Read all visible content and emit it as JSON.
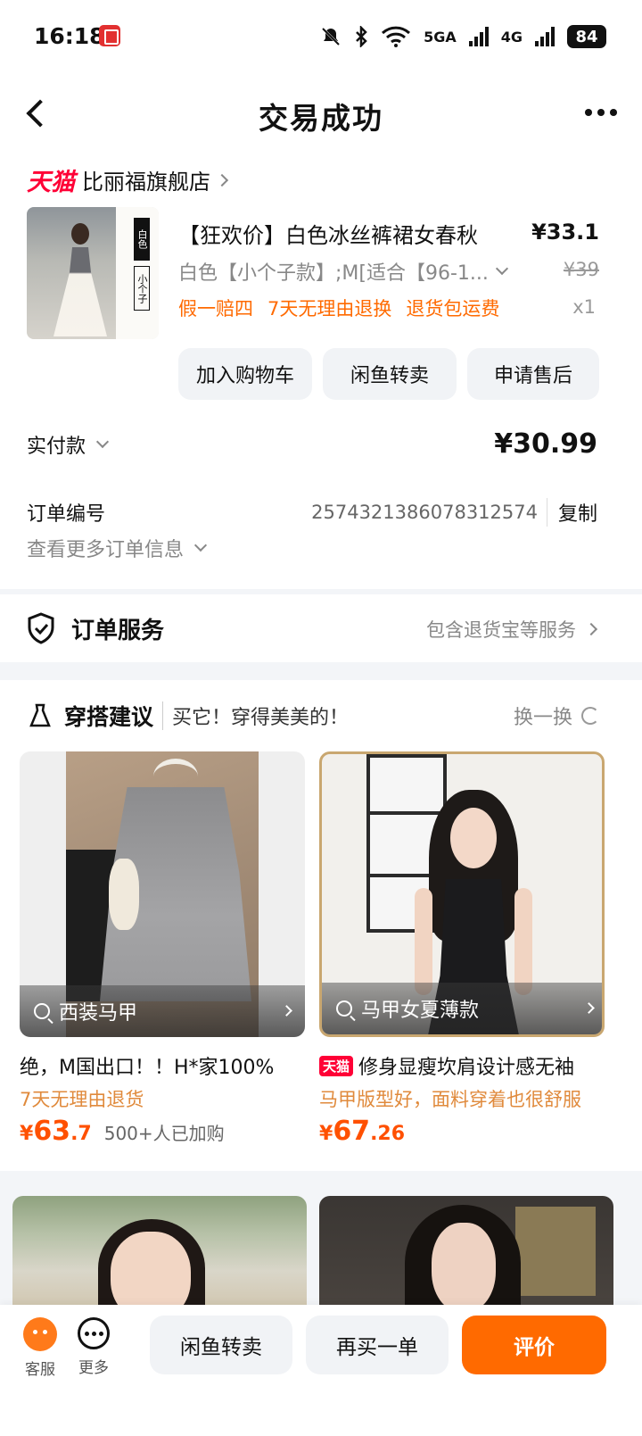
{
  "status_bar": {
    "time": "16:18",
    "net1": "5GA",
    "net2": "4G",
    "battery": "84"
  },
  "header": {
    "title": "交易成功"
  },
  "shop": {
    "platform_logo": "天猫",
    "name": "比丽福旗舰店"
  },
  "product": {
    "title": "【狂欢价】白色冰丝裤裙女春秋",
    "price": "¥33.1",
    "sku": "白色【小个子款】;M[适合【96-1...",
    "original_price": "¥39",
    "guarantees": [
      "假一赔四",
      "7天无理由退换",
      "退货包运费"
    ],
    "quantity": "x1",
    "thumb_tag1": "白色",
    "thumb_tag2": "小个子"
  },
  "actions": {
    "add_cart": "加入购物车",
    "resell": "闲鱼转卖",
    "after_sale": "申请售后"
  },
  "payment": {
    "label": "实付款",
    "amount": "¥30.99"
  },
  "order": {
    "label": "订单编号",
    "number": "2574321386078312574",
    "copy": "复制",
    "more": "查看更多订单信息"
  },
  "service": {
    "title": "订单服务",
    "link": "包含退货宝等服务"
  },
  "outfit": {
    "title": "穿搭建议",
    "subtitle": "买它！穿得美美的！",
    "refresh": "换一换",
    "items": [
      {
        "search_tag": "西装马甲",
        "title": "绝，M国出口！！H*家100%",
        "subtitle": "7天无理由退货",
        "price_yen": "¥",
        "price_int": "63",
        "price_dec": ".7",
        "extra": "500+人已加购",
        "badge": ""
      },
      {
        "search_tag": "马甲女夏薄款",
        "title": "修身显瘦坎肩设计感无袖",
        "subtitle": "马甲版型好，面料穿着也很舒服",
        "price_yen": "¥",
        "price_int": "67",
        "price_dec": ".26",
        "extra": "",
        "badge": "天猫"
      }
    ]
  },
  "bottom_bar": {
    "service": "客服",
    "more": "更多",
    "resell": "闲鱼转卖",
    "rebuy": "再买一单",
    "review": "评价"
  },
  "colors": {
    "accent": "#ff6a00",
    "tmall_red": "#ff0036",
    "price_orange": "#ff5000"
  }
}
